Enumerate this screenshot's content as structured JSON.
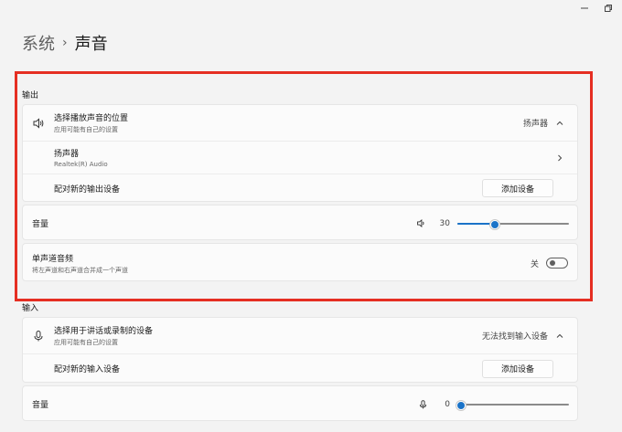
{
  "breadcrumb": {
    "parent": "系统",
    "separator": "›",
    "current": "声音"
  },
  "output": {
    "section_label": "输出",
    "choose_device": {
      "title": "选择播放声音的位置",
      "subtitle": "应用可能有自己的设置",
      "value": "扬声器",
      "icon": "speaker-icon"
    },
    "speaker": {
      "title": "扬声器",
      "subtitle": "Realtek(R) Audio"
    },
    "pair": {
      "label": "配对新的输出设备",
      "button": "添加设备"
    },
    "volume": {
      "label": "音量",
      "value": "30",
      "level": 30
    },
    "mono": {
      "title": "单声道音频",
      "subtitle": "将左声道和右声道合并成一个声道",
      "state_label": "关",
      "on": false
    }
  },
  "input": {
    "section_label": "输入",
    "choose_device": {
      "title": "选择用于讲话或录制的设备",
      "subtitle": "应用可能有自己的设置",
      "value": "无法找到输入设备",
      "icon": "microphone-icon"
    },
    "pair": {
      "label": "配对新的输入设备",
      "button": "添加设备"
    },
    "volume": {
      "label": "音量",
      "value": "0",
      "level": 0
    }
  },
  "colors": {
    "accent": "#1a73c8",
    "highlight_border": "#e52e22"
  }
}
